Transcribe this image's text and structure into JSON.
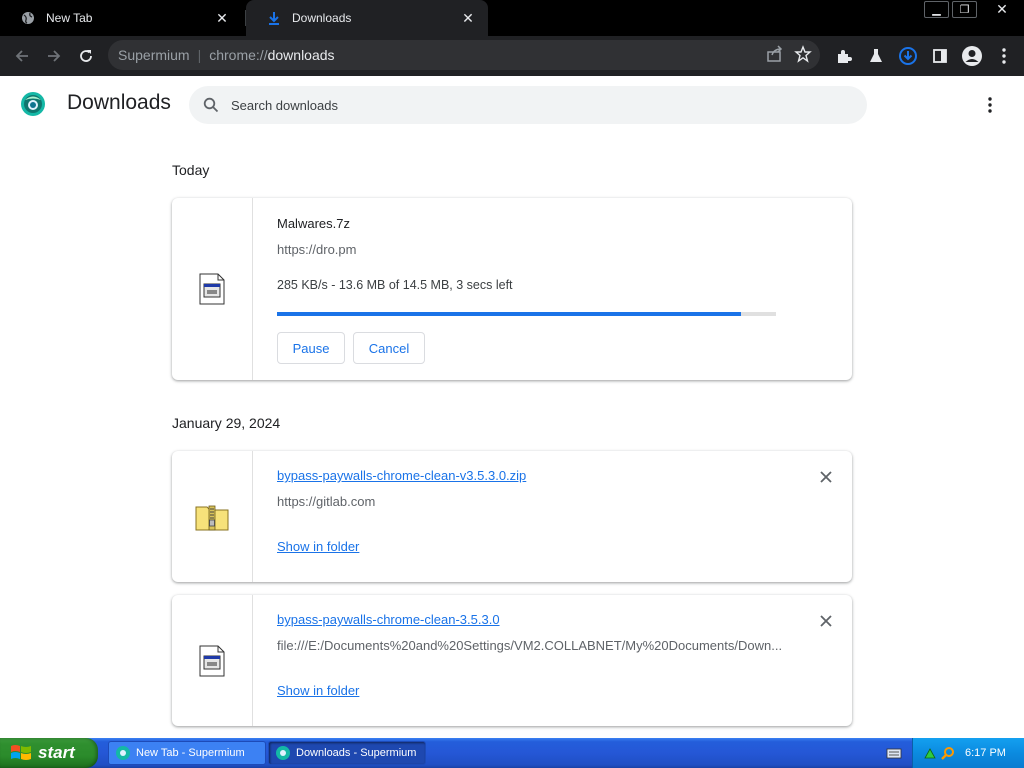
{
  "browser": {
    "tabs": [
      {
        "title": "New Tab"
      },
      {
        "title": "Downloads"
      }
    ],
    "omnibox": {
      "site_name": "Supermium",
      "url_scheme": "chrome://",
      "url_host": "downloads"
    }
  },
  "page": {
    "title": "Downloads",
    "search": {
      "placeholder": "Search downloads"
    },
    "sections": [
      {
        "heading": "Today",
        "items": [
          {
            "file_name": "Malwares.7z",
            "source": "https://dro.pm",
            "status": "285 KB/s - 13.6 MB of 14.5 MB, 3 secs left",
            "progress": 0.93,
            "pause_label": "Pause",
            "cancel_label": "Cancel",
            "icon": "generic-file-icon"
          }
        ]
      },
      {
        "heading": "January 29, 2024",
        "items": [
          {
            "file_name": "bypass-paywalls-chrome-clean-v3.5.3.0.zip",
            "source": "https://gitlab.com",
            "action_label": "Show in folder",
            "icon": "zip-folder-icon"
          },
          {
            "file_name": "bypass-paywalls-chrome-clean-3.5.3.0",
            "source": "file:///E:/Documents%20and%20Settings/VM2.COLLABNET/My%20Documents/Down...",
            "action_label": "Show in folder",
            "icon": "generic-file-icon"
          }
        ]
      }
    ]
  },
  "taskbar": {
    "start_label": "start",
    "tasks": [
      {
        "title": "New Tab - Supermium"
      },
      {
        "title": "Downloads - Supermium"
      }
    ],
    "clock": "6:17 PM"
  },
  "colors": {
    "accent": "#1a73e8",
    "tab_bar": "#000000",
    "toolbar": "#202124",
    "taskbar": "#245edb",
    "start": "#2f8f2f"
  }
}
